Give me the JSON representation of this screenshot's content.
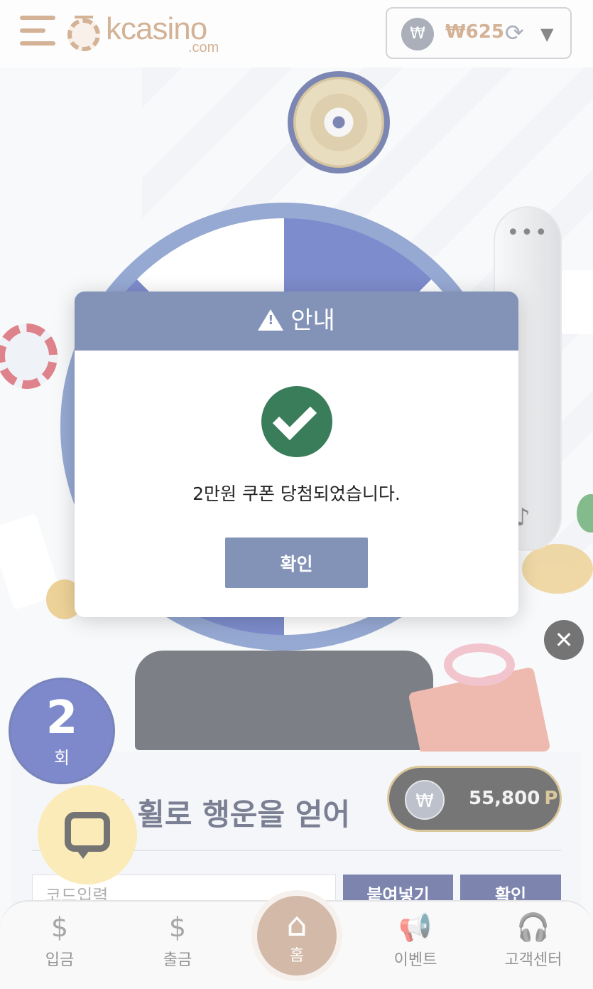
{
  "header": {
    "logo_text": "kcasino",
    "logo_sub": ".com",
    "wallet_symbol": "₩",
    "wallet_amount": "₩625",
    "refresh_glyph": "⟳",
    "caret_glyph": "▼"
  },
  "side_panel": {
    "menu_glyph": "•••",
    "mute_glyph": "♪"
  },
  "reward": {
    "close_glyph": "✕",
    "coin_symbol": "₩",
    "points": "55,800",
    "unit": "P"
  },
  "round": {
    "number": "2",
    "label": "회"
  },
  "content": {
    "headline": "키 휠로 행운을 얻어",
    "code_placeholder": "코드입력",
    "paste_label": "붙여넣기",
    "check_label": "확인"
  },
  "bottom_nav": {
    "deposit": {
      "icon": "deposit-icon",
      "glyph": "$",
      "label": "입금"
    },
    "withdraw": {
      "icon": "withdraw-icon",
      "glyph": "$",
      "label": "출금"
    },
    "home": {
      "icon": "home-icon",
      "glyph": "⌂",
      "label": "홈"
    },
    "event": {
      "icon": "megaphone-icon",
      "glyph": "📢",
      "label": "이벤트"
    },
    "support": {
      "icon": "headset-icon",
      "glyph": "🎧",
      "label": "고객센터"
    }
  },
  "modal": {
    "title": "안내",
    "message": "2만원 쿠폰 당첨되었습니다.",
    "ok_label": "확인"
  },
  "colors": {
    "brand": "#b47a4b",
    "modal_header": "#8393b8",
    "success": "#3a7d5a",
    "navy": "#1f2e74"
  }
}
